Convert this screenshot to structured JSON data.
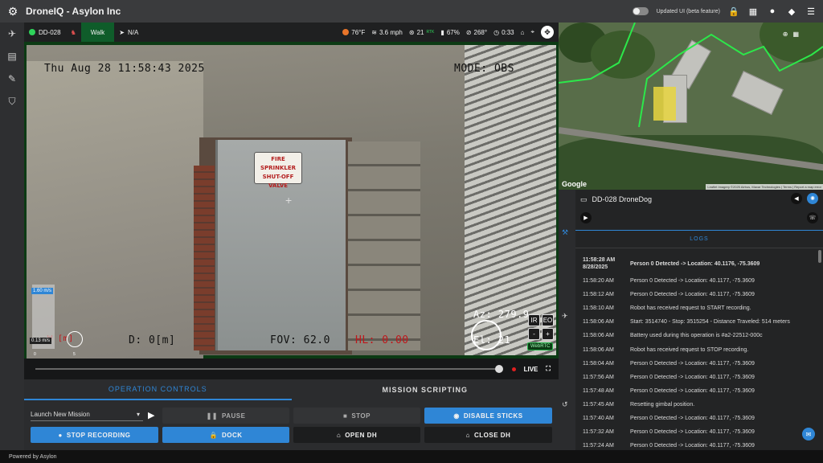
{
  "app": {
    "title": "DroneIQ - Asylon Inc",
    "footer": "Powered by Asylon"
  },
  "topbar": {
    "beta_label": "Updated UI (beta feature)"
  },
  "status": {
    "robot_id": "DD-028",
    "mode": "Walk",
    "gps_label": "N/A",
    "temperature": "76°F",
    "wind": "3.6 mph",
    "satellites": "21",
    "rtk_label": "RTK",
    "battery": "67%",
    "heading": "268°",
    "timer": "0:33"
  },
  "video": {
    "timestamp": "Thu Aug 28 11:58:43 2025",
    "mode": "MODE: OBS",
    "distance": "D: 0[m]",
    "fov": "FOV: 62.0",
    "bottom_left": "W [m]",
    "bottom_right": "HL: 0.00",
    "az": "Az: 279.9",
    "el": "El: 21",
    "sign_text": "FIRE SPRINKLER SHUT-OFF VALVE",
    "speed_max": "1.60 m/s",
    "speed_cur": "0.13 m/s",
    "scale_left": "0",
    "scale_right": "5",
    "ir_label": "IR",
    "eo_label": "EO",
    "zoom_out": "-",
    "zoom_in": "+",
    "webrtc_label": "WebRTC",
    "live_label": "LIVE"
  },
  "controls": {
    "tab_operation": "OPERATION CONTROLS",
    "tab_scripting": "MISSION SCRIPTING",
    "mission_select": "Launch New Mission",
    "pause": "PAUSE",
    "stop": "STOP",
    "disable_sticks": "DISABLE STICKS",
    "stop_recording": "STOP RECORDING",
    "dock": "DOCK",
    "open_dh": "OPEN DH",
    "close_dh": "CLOSE DH"
  },
  "map": {
    "provider": "Google",
    "attribution": "Imagery ©2025 Airbus, Maxar Technologies | Terms | Report a map error",
    "leaflet": "Leaflet"
  },
  "robot_panel": {
    "name": "DD-028 DroneDog"
  },
  "logs": {
    "title": "LOGS",
    "entries": [
      {
        "time": "11:58:28 AM",
        "date": "8/28/2025",
        "msg": "Person 0 Detected -> Location: 40.1176, -75.3609",
        "bold": true
      },
      {
        "time": "11:58:20 AM",
        "msg": "Person 0 Detected -> Location: 40.1177, -75.3609"
      },
      {
        "time": "11:58:12 AM",
        "msg": "Person 0 Detected -> Location: 40.1177, -75.3609"
      },
      {
        "time": "11:58:10 AM",
        "msg": "Robot has received request to START recording."
      },
      {
        "time": "11:58:06 AM",
        "msg": "Start: 3514740 - Stop: 3515254 - Distance Traveled: 514 meters"
      },
      {
        "time": "11:58:06 AM",
        "msg": "Battery used during this operation is #a2-22512-000c"
      },
      {
        "time": "11:58:06 AM",
        "msg": "Robot has received request to STOP recording."
      },
      {
        "time": "11:58:04 AM",
        "msg": "Person 0 Detected -> Location: 40.1177, -75.3609"
      },
      {
        "time": "11:57:56 AM",
        "msg": "Person 0 Detected -> Location: 40.1177, -75.3609"
      },
      {
        "time": "11:57:48 AM",
        "msg": "Person 0 Detected -> Location: 40.1177, -75.3609"
      },
      {
        "time": "11:57:45 AM",
        "msg": "Resetting gimbal position."
      },
      {
        "time": "11:57:40 AM",
        "msg": "Person 0 Detected -> Location: 40.1177, -75.3609"
      },
      {
        "time": "11:57:32 AM",
        "msg": "Person 0 Detected -> Location: 40.1177, -75.3609"
      },
      {
        "time": "11:57:24 AM",
        "msg": "Person 0 Detected -> Location: 40.1177, -75.3609"
      }
    ]
  },
  "colors": {
    "accent": "#2f86d6",
    "status_green": "#0f5c2a",
    "danger": "#e02020"
  }
}
